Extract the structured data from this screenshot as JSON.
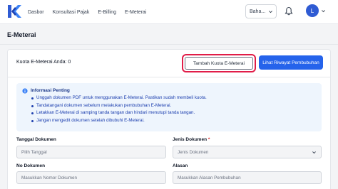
{
  "nav": {
    "items": [
      "Dasbor",
      "Konsultasi Pajak",
      "E-Billing",
      "E-Meterai"
    ]
  },
  "header": {
    "language": "Baha...",
    "avatar_initial": "L"
  },
  "page": {
    "title": "E-Meterai"
  },
  "quota": {
    "label": "Kuota E-Meterai Anda: 0",
    "add_button": "Tambah Kuota E-Meterai",
    "history_button": "Lihat Riwayat Pembubuhan"
  },
  "info": {
    "title": "Informasi Penting",
    "items": [
      "Unggah dokumen PDF untuk menggunakan E-Meterai. Pastikan sudah membeli kuota.",
      "Tandatangani dokumen sebelum melakukan pembubuhan E-Meterai.",
      "Letakkan E-Meterai di samping tanda tangan dan hindari menutupi tanda tangan.",
      "Jangan mengedit dokumen setelah dibubuhi E-Meterai."
    ]
  },
  "form": {
    "tanggal_label": "Tanggal Dokumen",
    "tanggal_placeholder": "Pilih Tanggal",
    "jenis_label": "Jenis Dokumen",
    "jenis_required": "*",
    "jenis_placeholder": "Jenis Dokumen",
    "no_label": "No Dokumen",
    "no_placeholder": "Masukkan Nomor Dokumen",
    "alasan_label": "Alasan",
    "alasan_placeholder": "Masukkan Alasan Pembubuhan"
  },
  "colors": {
    "brand": "#2563eb",
    "highlight": "#e11d48",
    "info_bg": "#eef5fd"
  },
  "icons": [
    "logo-icon",
    "chevron-down-icon",
    "bell-icon",
    "info-icon"
  ]
}
